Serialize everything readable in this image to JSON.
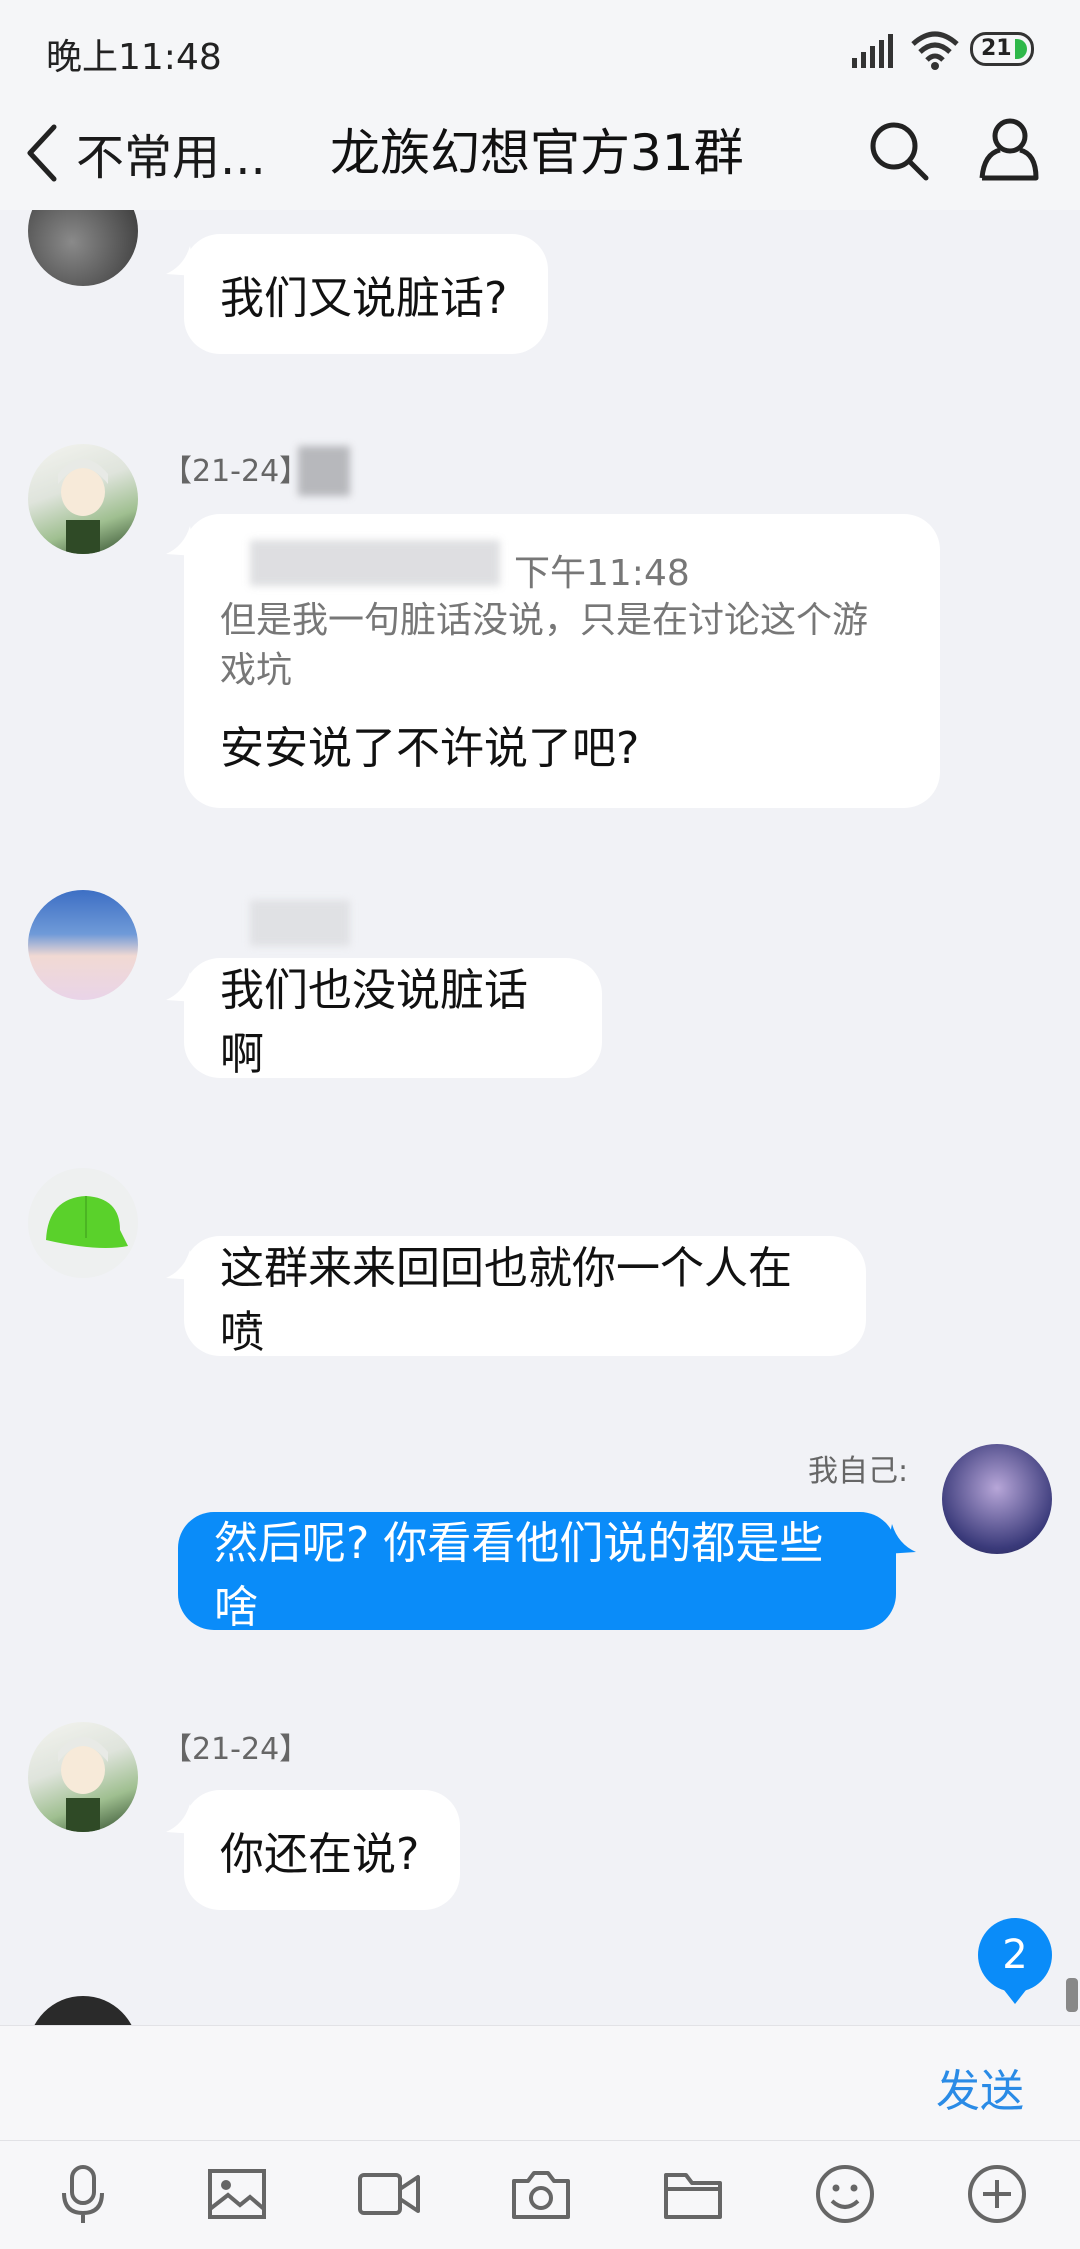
{
  "status_bar": {
    "time": "晚上11:48",
    "battery": "21"
  },
  "nav": {
    "back_label": "不常用...",
    "title": "龙族幻想官方31群"
  },
  "messages": [
    {
      "text": "我们又说脏话?"
    },
    {
      "sender": "【21-24】",
      "quote_time": "下午11:48",
      "quote_text": "但是我一句脏话没说，只是在讨论这个游戏坑",
      "text": "安安说了不许说了吧?"
    },
    {
      "text": "我们也没说脏话啊"
    },
    {
      "text": "这群来来回回也就你一个人在喷"
    },
    {
      "sender": "我自己:",
      "text": "然后呢? 你看看他们说的都是些啥"
    },
    {
      "sender": "【21-24】",
      "text": "你还在说?"
    }
  ],
  "unread_count": "2",
  "input": {
    "send_label": "发送"
  },
  "toolbar_icons": [
    "microphone-icon",
    "image-icon",
    "video-icon",
    "camera-icon",
    "folder-icon",
    "emoji-icon",
    "plus-icon"
  ],
  "colors": {
    "accent": "#0a8cf9",
    "send": "#2a8be6",
    "background": "#f1f2f6"
  }
}
